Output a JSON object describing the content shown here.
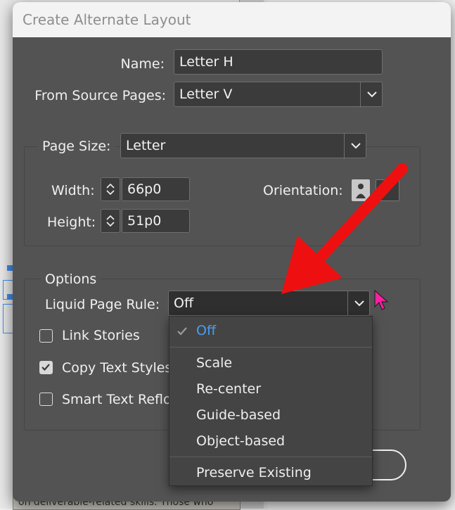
{
  "dialog": {
    "title": "Create Alternate Layout",
    "name_label": "Name:",
    "name_value": "Letter H",
    "source_label": "From Source Pages:",
    "source_value": "Letter V",
    "page_size_label": "Page Size:",
    "page_size_value": "Letter",
    "width_label": "Width:",
    "width_value": "66p0",
    "height_label": "Height:",
    "height_value": "51p0",
    "orientation_label": "Orientation:",
    "options_label": "Options",
    "liquid_label": "Liquid Page Rule:",
    "liquid_value": "Off",
    "checkboxes": [
      {
        "label": "Link Stories",
        "checked": false
      },
      {
        "label": "Copy Text Styles",
        "checked": true
      },
      {
        "label": "Smart Text Reflo",
        "checked": false
      }
    ]
  },
  "liquid_menu": {
    "items": [
      "Off",
      "Scale",
      "Re-center",
      "Guide-based",
      "Object-based",
      "Preserve Existing"
    ],
    "selected": "Off"
  },
  "background": {
    "text": "on deliverable-related skills. Those who"
  },
  "colors": {
    "dialog_bg": "#535353",
    "selected_item": "#4a9df0",
    "annotation_arrow": "#ee1010",
    "cursor": "#ff1fa0"
  }
}
